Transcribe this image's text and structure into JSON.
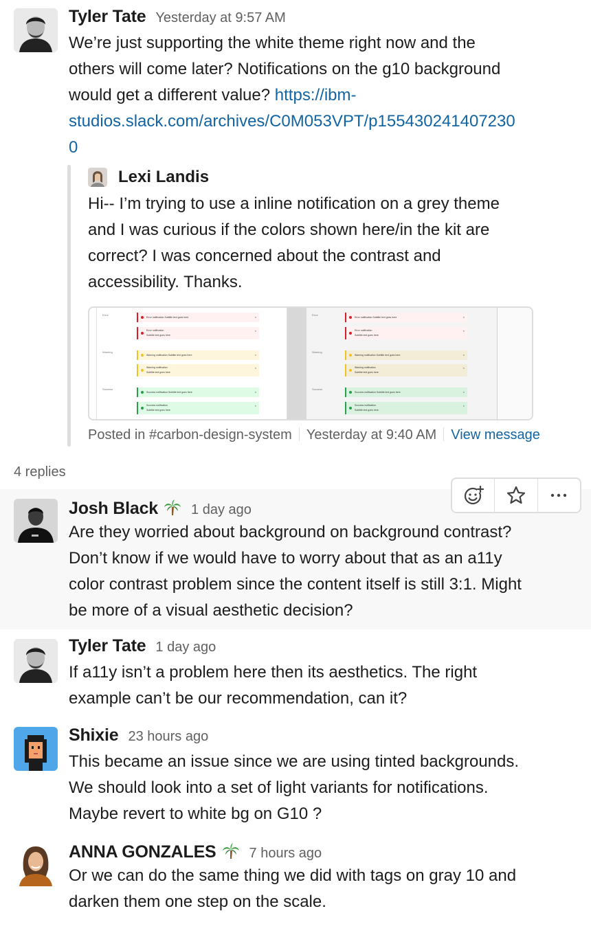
{
  "messages": [
    {
      "author": "Tyler Tate",
      "time": "Yesterday at 9:57 AM",
      "text_lines": [
        "We’re just supporting the white theme right now and the",
        "others will come later? Notifications on the g10 background",
        "would get a different value?"
      ],
      "link_parts": [
        "https://ibm-",
        "studios.slack.com/archives/C0M053VPT/p155430241407230",
        "0"
      ],
      "quoted": {
        "author": "Lexi Landis",
        "text_lines": [
          "Hi-- I’m trying to use a inline notification on a grey theme",
          "and I was curious if the colors shown here/in the kit are",
          "correct? I was concerned about the contrast and",
          "accessibility. Thanks."
        ],
        "footer": {
          "posted_in": "Posted in #carbon-design-system",
          "time": "Yesterday at 9:40 AM",
          "view": "View message"
        },
        "image": {
          "rows": [
            "Error",
            "Warning",
            "Success"
          ],
          "single_error": "Error notification  Subtitle text goes here",
          "double_error_title": "Error notification",
          "double_error_sub": "Subtitle text goes here",
          "single_warning": "Warning notification  Subtitle text goes here",
          "double_warning_title": "Warning notification",
          "double_warning_sub": "Subtitle text goes here",
          "single_success": "Success notification  Subtitle text goes here",
          "double_success_title": "Success notification",
          "double_success_sub": "Subtitle text goes here"
        }
      }
    },
    {
      "author": "Josh Black",
      "time": "1 day ago",
      "emoji": "palm-tree-icon",
      "text_lines": [
        "Are they worried about background on background contrast?",
        "Don’t know if we would have to worry about that as an a11y",
        "color contrast problem since the content itself is still 3:1. Might",
        "be more of a visual aesthetic decision?"
      ]
    },
    {
      "author": "Tyler Tate",
      "time": "1 day ago",
      "text_lines": [
        "If a11y isn’t a problem here then its aesthetics. The right",
        "example can’t be our recommendation, can it?"
      ]
    },
    {
      "author": "Shixie",
      "time": "23 hours ago",
      "text_lines": [
        "This became an issue since we are using tinted backgrounds.",
        "We should look into a set of light variants for notifications.",
        "Maybe revert to white bg on G10 ?"
      ]
    },
    {
      "author": "ANNA GONZALES",
      "time": "7 hours ago",
      "emoji": "palm-tree-icon",
      "text_lines": [
        "Or we can do the same thing we did with tags on gray 10 and",
        "darken them one step on the scale."
      ]
    }
  ],
  "replies_label": "4 replies",
  "actions": [
    "add-reaction-icon",
    "star-icon",
    "more-actions-icon"
  ],
  "colors": {
    "link": "#1264a3",
    "muted": "#616061",
    "hover_bg": "#f8f8f8",
    "error": "#da1e28",
    "warning": "#f1c21b",
    "success": "#24a148"
  }
}
